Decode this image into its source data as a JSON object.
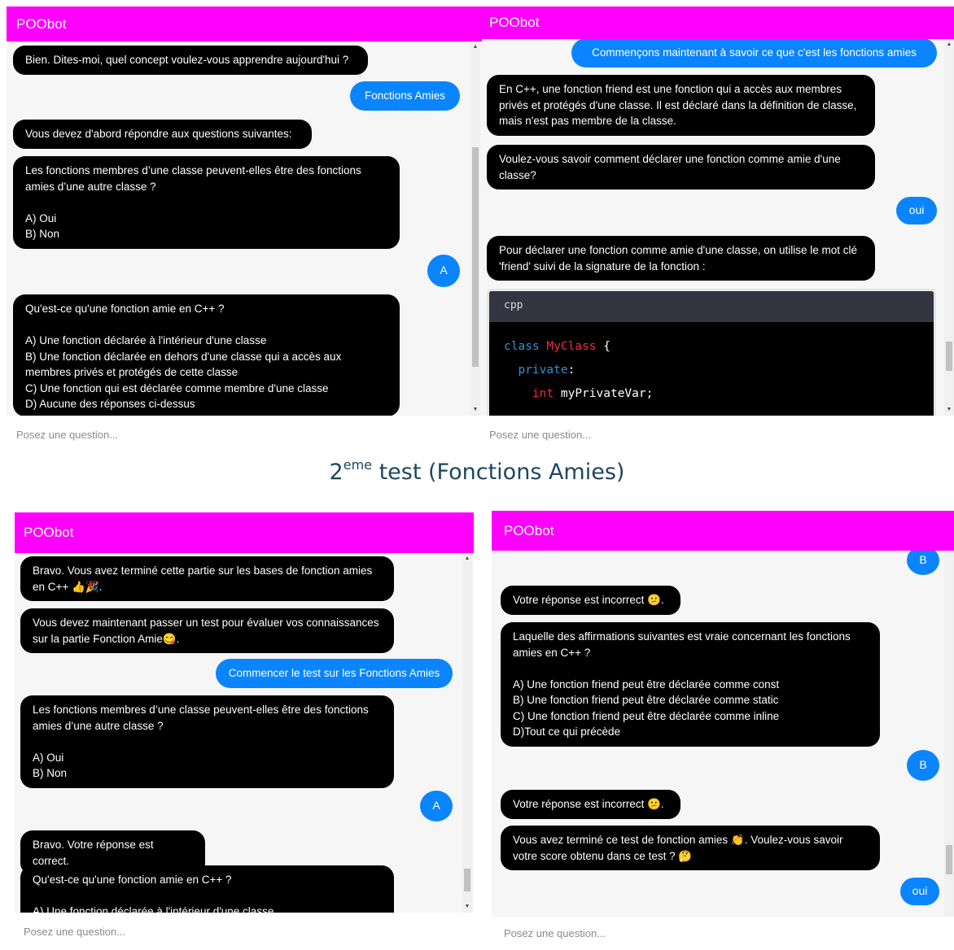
{
  "app": {
    "title": "POObot",
    "input_placeholder": "Posez une question..."
  },
  "caption": {
    "prefix": "2",
    "sup": "eme",
    "rest": " test (Fonctions Amies)"
  },
  "panel1": {
    "messages": [
      "Bien. Dites-moi, quel concept voulez-vous apprendre aujourd'hui ?",
      "Fonctions Amies",
      "Vous devez d'abord répondre aux questions suivantes:",
      "Les fonctions membres d’une classe peuvent-elles être des fonctions amies d’une autre classe ?\n\nA) Oui\nB) Non",
      "A",
      "Qu'est-ce qu'une fonction amie en C++ ?\n\nA) Une fonction déclarée à l'intérieur d'une classe\nB) Une fonction déclarée en dehors d'une classe qui a accès aux membres privés et protégés de cette classe\nC) Une fonction qui est déclarée comme membre d'une classe\nD) Aucune des réponses ci-dessus"
    ]
  },
  "panel2": {
    "messages": [
      "Commençons maintenant à savoir ce que c'est les fonctions amies",
      "En C++, une fonction friend est une fonction qui a accès aux membres privés et protégés d'une classe. Il est déclaré dans la définition de classe, mais n'est pas membre de la classe.",
      "Voulez-vous savoir comment déclarer une fonction comme amie d'une classe?",
      "oui",
      "Pour déclarer une fonction comme amie d'une classe, on utilise le mot clé 'friend' suivi de la signature de la fonction :"
    ],
    "code": {
      "lang": "cpp",
      "line1_kw": "class",
      "line1_name": "MyClass",
      "line1_brace": " {",
      "line2_kw": "private",
      "line2_colon": ":",
      "line3_type": "int",
      "line3_var": " myPrivateVar;"
    }
  },
  "panel3": {
    "messages": [
      "Bravo. Vous avez terminé cette partie sur les bases de fonction amies en C++ 👍🎉.",
      "Vous devez maintenant passer un test pour évaluer vos connaissances sur la partie Fonction Amie😋.",
      "Commencer le test sur les Fonctions Amies",
      "Les fonctions membres d’une classe peuvent-elles être des fonctions amies d’une autre classe ?\n\nA) Oui\nB) Non",
      "A",
      "Bravo. Votre réponse est correct.",
      "Qu'est-ce qu'une fonction amie en C++ ?\n\nA) Une fonction déclarée à l'intérieur d'une classe"
    ]
  },
  "panel4": {
    "messages": [
      "B",
      "Votre réponse est incorrect 😕.",
      "Laquelle des affirmations suivantes est vraie concernant les fonctions amies en C++ ?\n\nA) Une fonction friend peut être déclarée comme const\nB) Une fonction friend peut être déclarée comme static\nC) Une fonction friend peut être déclarée comme inline\nD)Tout ce qui précède",
      "B",
      "Votre réponse est incorrect 😕.",
      "Vous avez terminé ce test de fonction amies 👏. Voulez-vous savoir votre score obtenu dans ce test ? 🤔",
      "oui"
    ]
  }
}
